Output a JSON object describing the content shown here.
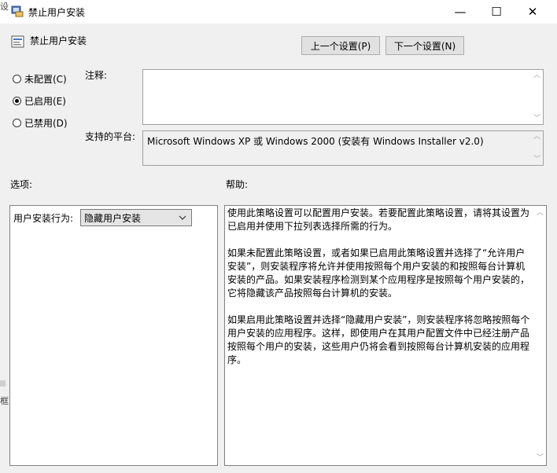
{
  "window": {
    "title": "禁止用户安装",
    "minimize_glyph": "—",
    "maximize_glyph": "☐",
    "close_glyph": "✕",
    "left_edge_text": [
      "设",
      "框"
    ]
  },
  "header": {
    "policy_name": "禁止用户安装",
    "prev_button": "上一个设置(P)",
    "next_button": "下一个设置(N)"
  },
  "state": {
    "options": [
      {
        "label": "未配置(C)",
        "selected": false
      },
      {
        "label": "已启用(E)",
        "selected": true
      },
      {
        "label": "已禁用(D)",
        "selected": false
      }
    ]
  },
  "comment": {
    "label": "注释:",
    "value": ""
  },
  "supported": {
    "label": "支持的平台:",
    "value": "Microsoft Windows XP 或 Windows 2000 (安装有 Windows Installer v2.0)"
  },
  "options_section": {
    "label": "选项:",
    "field_label": "用户安装行为:",
    "selected_value": "隐藏用户安装"
  },
  "help_section": {
    "label": "帮助:",
    "paragraphs": [
      "使用此策略设置可以配置用户安装。若要配置此策略设置，请将其设置为已启用并使用下拉列表选择所需的行为。",
      "如果未配置此策略设置，或者如果已启用此策略设置并选择了“允许用户安装”，则安装程序将允许并使用按照每个用户安装的和按照每台计算机安装的产品。如果安装程序检测到某个应用程序是按照每个用户安装的，它将隐藏该产品按照每台计算机的安装。",
      "如果启用此策略设置并选择“隐藏用户安装”，则安装程序将忽略按照每个用户安装的应用程序。这样，即使用户在其用户配置文件中已经注册产品按照每个用户的安装，这些用户仍将会看到按照每台计算机安装的应用程序。"
    ]
  },
  "colors": {
    "title_bar": "#ffffff",
    "dialog_bg": "#f0f0f0",
    "button_bg": "#e1e1e1",
    "combo_bg": "#e5e5e5"
  }
}
